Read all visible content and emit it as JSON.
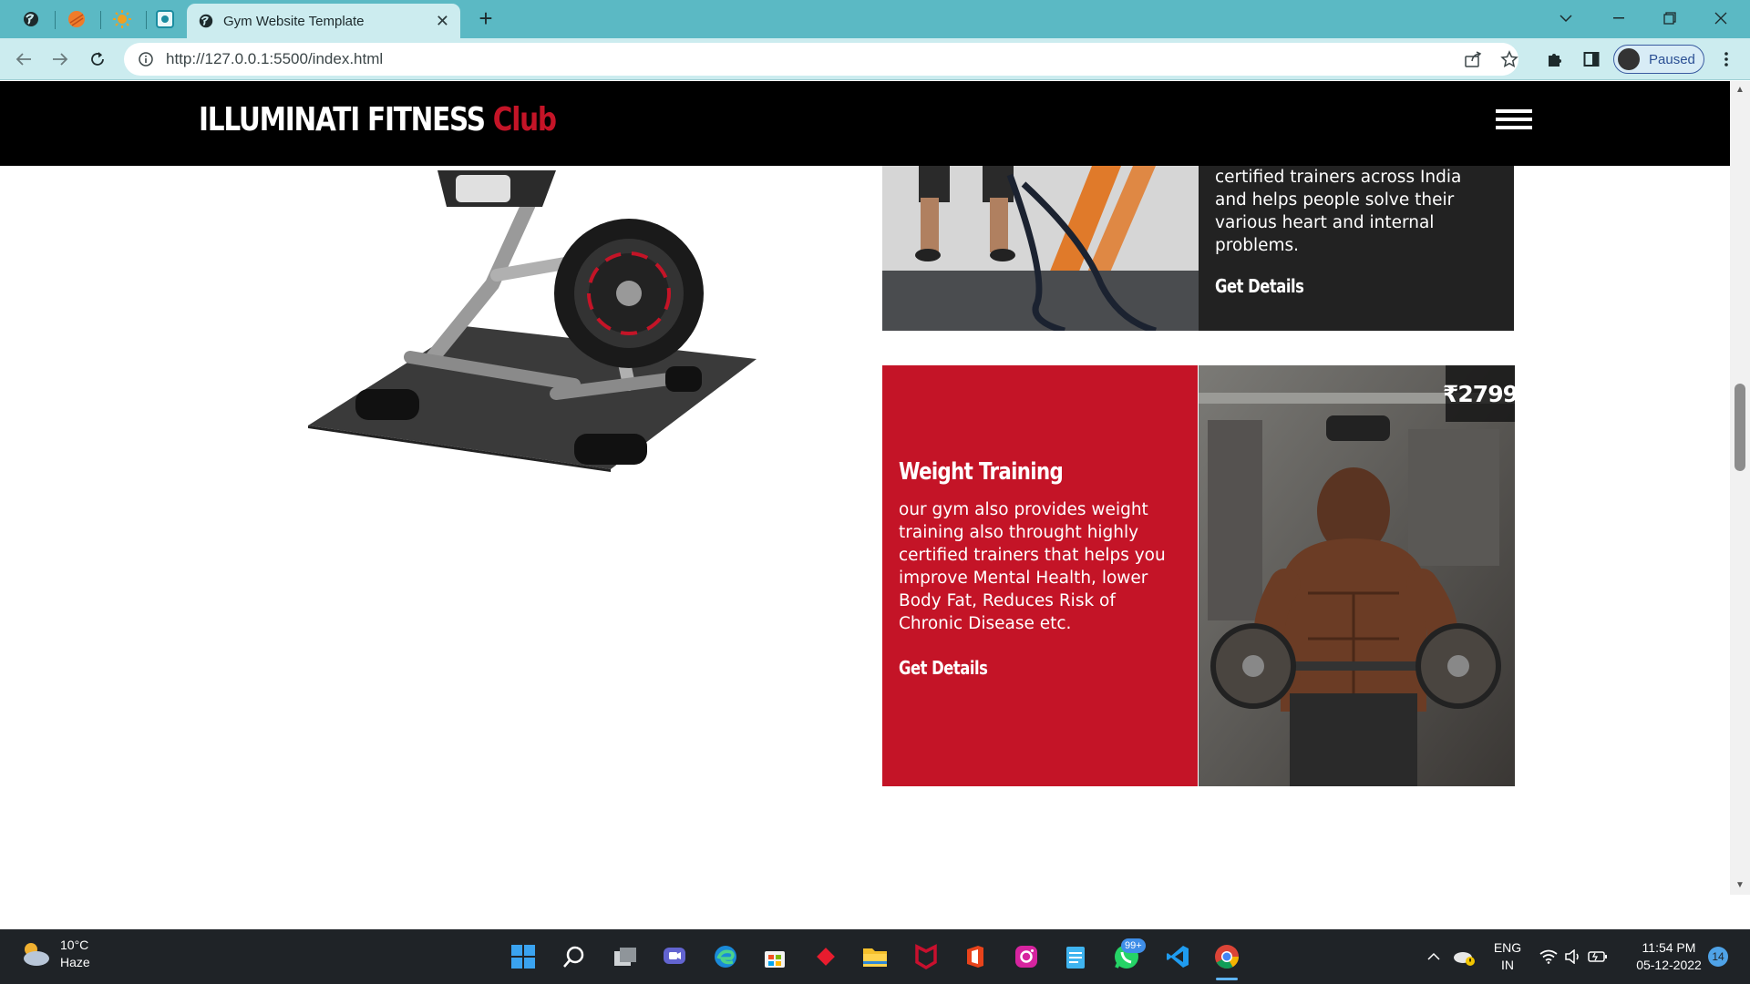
{
  "browser": {
    "active_tab_title": "Gym Website Template",
    "url": "http://127.0.0.1:5500/index.html",
    "profile_status": "Paused",
    "accent_color": "#5bb9c4"
  },
  "site": {
    "logo_main": "ILLUMINATI FITNESS",
    "logo_accent": "Club",
    "brand_red": "#c41427"
  },
  "cards": {
    "top": {
      "description": "certified trainers across India and helps people solve their various heart and internal problems.",
      "cta": "Get Details"
    },
    "weight_training": {
      "heading": "Weight Training",
      "description": "our gym also provides weight training also throught highly certified trainers that helps you improve Mental Health, lower Body Fat, Reduces Risk of Chronic Disease etc.",
      "cta": "Get Details",
      "price": "₹2799"
    }
  },
  "taskbar": {
    "temperature": "10°C",
    "weather": "Haze",
    "language_line1": "ENG",
    "language_line2": "IN",
    "time": "11:54 PM",
    "date": "05-12-2022",
    "whatsapp_badge": "99+",
    "notification_count": "14"
  }
}
